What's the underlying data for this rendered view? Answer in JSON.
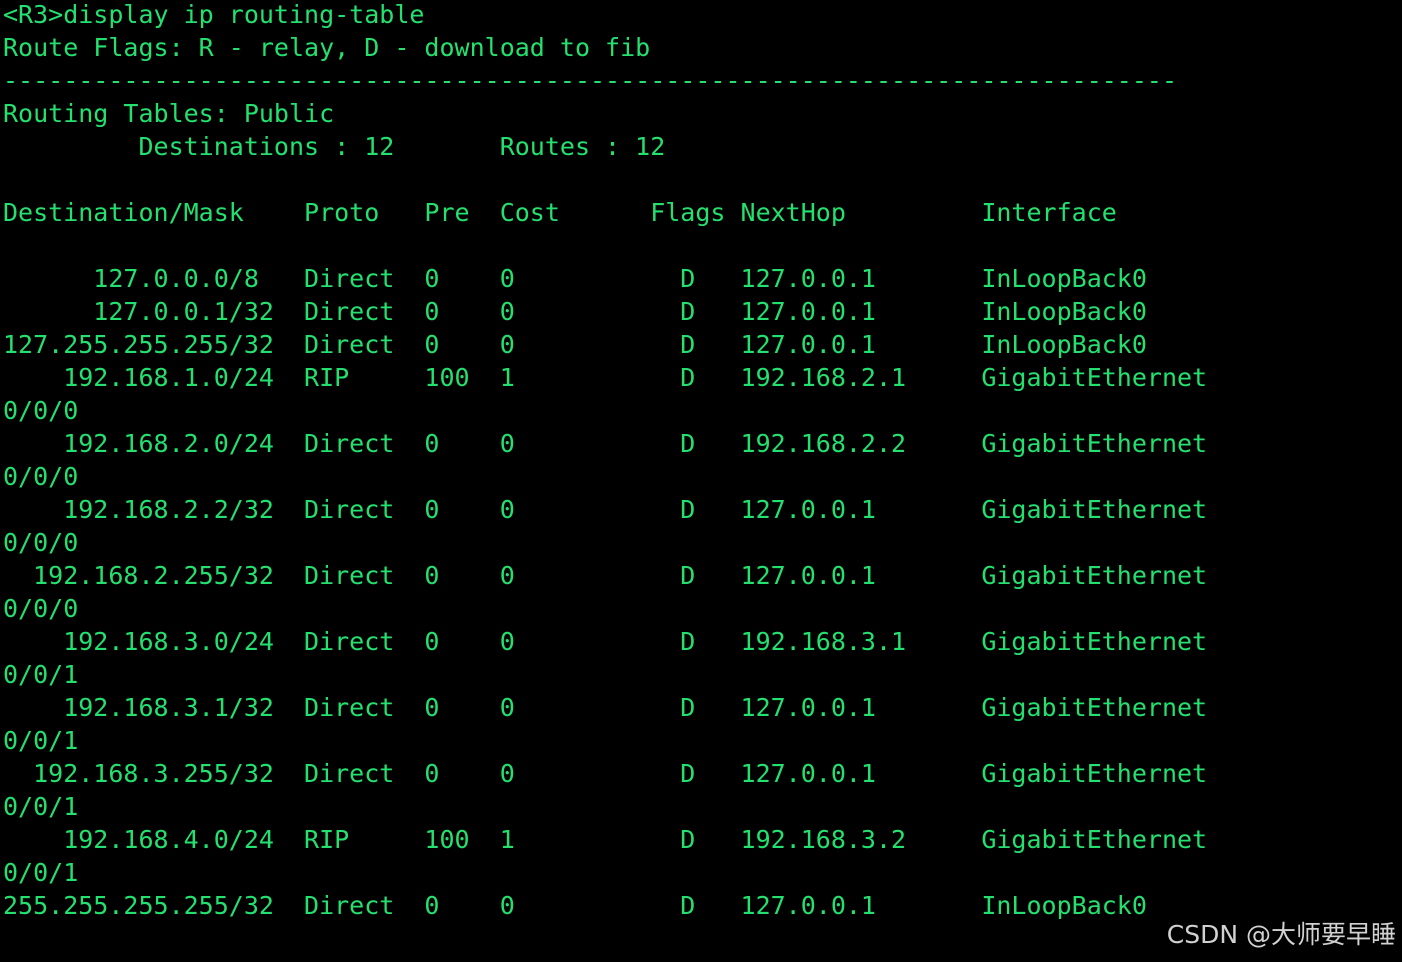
{
  "terminal": {
    "lines": [
      "<R3>display ip routing-table",
      "Route Flags: R - relay, D - download to fib",
      "------------------------------------------------------------------------------",
      "Routing Tables: Public",
      "         Destinations : 12       Routes : 12",
      "",
      "Destination/Mask    Proto   Pre  Cost      Flags NextHop         Interface",
      "",
      "      127.0.0.0/8   Direct  0    0           D   127.0.0.1       InLoopBack0",
      "      127.0.0.1/32  Direct  0    0           D   127.0.0.1       InLoopBack0",
      "127.255.255.255/32  Direct  0    0           D   127.0.0.1       InLoopBack0",
      "    192.168.1.0/24  RIP     100  1           D   192.168.2.1     GigabitEthernet",
      "0/0/0",
      "    192.168.2.0/24  Direct  0    0           D   192.168.2.2     GigabitEthernet",
      "0/0/0",
      "    192.168.2.2/32  Direct  0    0           D   127.0.0.1       GigabitEthernet",
      "0/0/0",
      "  192.168.2.255/32  Direct  0    0           D   127.0.0.1       GigabitEthernet",
      "0/0/0",
      "    192.168.3.0/24  Direct  0    0           D   192.168.3.1     GigabitEthernet",
      "0/0/1",
      "    192.168.3.1/32  Direct  0    0           D   127.0.0.1       GigabitEthernet",
      "0/0/1",
      "  192.168.3.255/32  Direct  0    0           D   127.0.0.1       GigabitEthernet",
      "0/0/1",
      "    192.168.4.0/24  RIP     100  1           D   192.168.3.2     GigabitEthernet",
      "0/0/1",
      "255.255.255.255/32  Direct  0    0           D   127.0.0.1       InLoopBack0"
    ]
  },
  "watermark": {
    "text": "CSDN @大师要早睡"
  },
  "colors": {
    "background": "#000000",
    "text": "#24e06f"
  }
}
